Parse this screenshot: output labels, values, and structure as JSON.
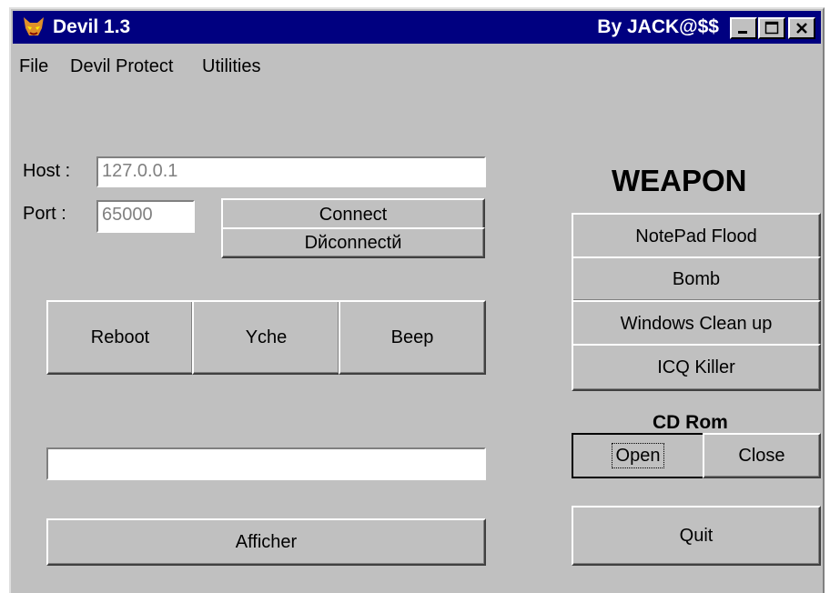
{
  "window": {
    "title": "Devil 1.3",
    "author": "By JACK@$$",
    "title_bar_color": "#000080",
    "controls": [
      "minimize-icon",
      "maximize-icon",
      "close-icon"
    ]
  },
  "menu": [
    "File",
    "Devil Protect",
    "Utilities"
  ],
  "connection": {
    "host_label": "Host :",
    "host_value": "127.0.0.1",
    "port_label": "Port :",
    "port_value": "65000",
    "connect_label": "Connect",
    "disconnect_label": "Dйconnectй"
  },
  "actions": [
    "Reboot",
    "Yche",
    "Beep"
  ],
  "message": {
    "value": "",
    "send_label": "Afficher"
  },
  "weapon": {
    "heading": "WEAPON",
    "items": [
      "NotePad Flood",
      "Bomb",
      "Windows Clean up",
      "ICQ Killer"
    ]
  },
  "cdrom": {
    "heading": "CD Rom",
    "open_label": "Open",
    "close_label": "Close"
  },
  "quit_label": "Quit"
}
